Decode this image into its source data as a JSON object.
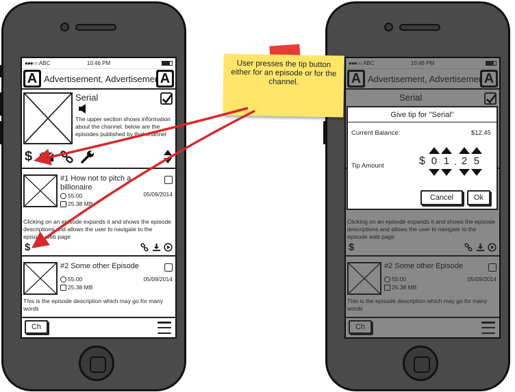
{
  "status": {
    "carrier": "ABC",
    "time": "10:46 PM"
  },
  "header": {
    "logo": "A",
    "title": "Advertisement, Advertisement"
  },
  "channel": {
    "title": "Serial",
    "description": "The upper section shows information about the channel. below are the episodes published by that channel",
    "tip_symbol": "$"
  },
  "episodes": [
    {
      "title": "#1 How not to pitch a billionaire",
      "duration": "55:00",
      "size": "25.38 MB",
      "date": "05/09/2014",
      "description": "Clicking on an episode expands it and shows the episode descriptions and allows the user to navigate to the episode web page",
      "tip_symbol": "$"
    },
    {
      "title": "#2 Some other Episode",
      "duration": "55:00",
      "size": "25.38 MB",
      "date": "05/09/2014",
      "description": "This is the episode description which may go for many words"
    }
  ],
  "tabbar": {
    "channel_tab": "Ch"
  },
  "dialog": {
    "title": "Give tip for \"Serial\"",
    "balance_label": "Current Balance:",
    "balance_value": "$12.45",
    "tip_label": "Tip Amount",
    "currency": "$",
    "digits": [
      "0",
      "1",
      "2",
      "5"
    ],
    "separator": ".",
    "cancel_label": "Cancel",
    "ok_label": "Ok"
  },
  "note": {
    "text": "User presses the tip button either for an episode or for the channel.",
    "color": "#ffe66a",
    "tape_color": "#e8322a",
    "arrow_color": "#d42a2a"
  }
}
